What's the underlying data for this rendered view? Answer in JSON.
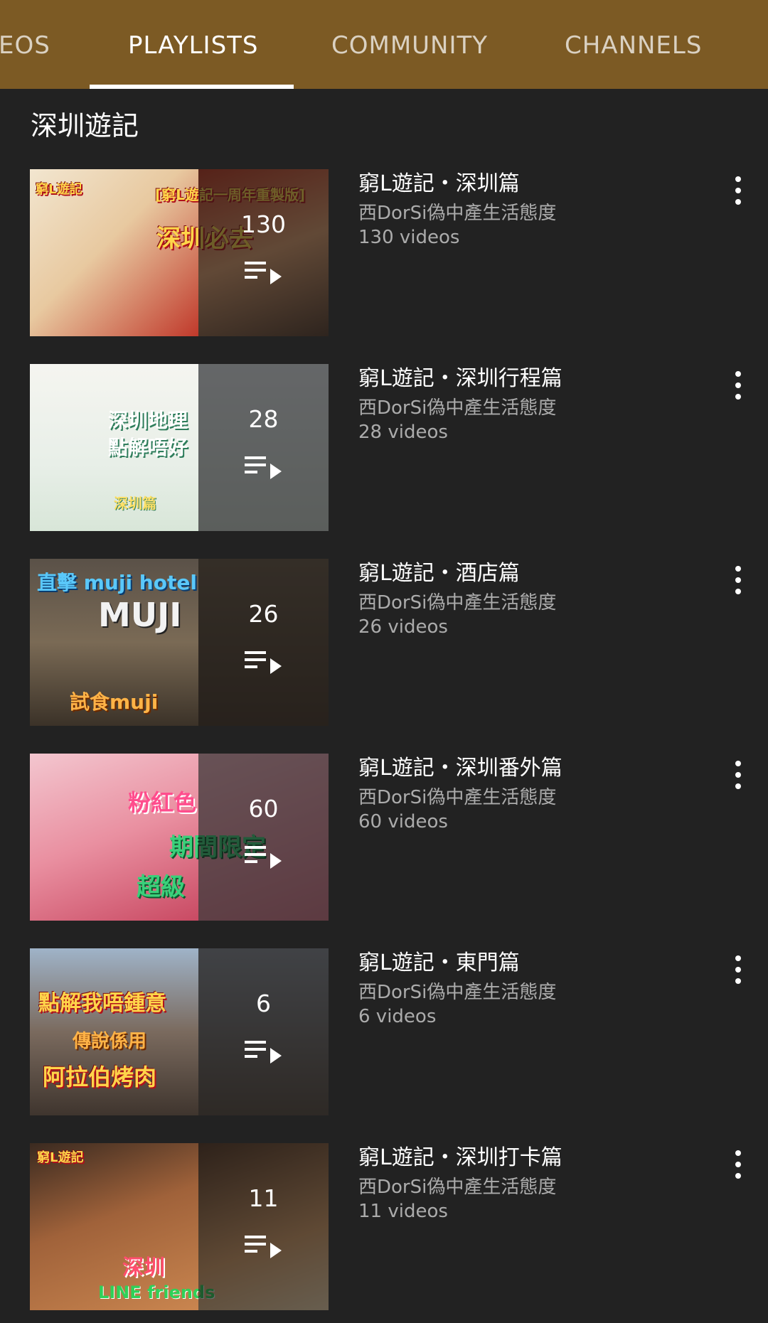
{
  "tabs": [
    {
      "label": "VIDEOS",
      "display": "EOS"
    },
    {
      "label": "PLAYLISTS",
      "display": "PLAYLISTS"
    },
    {
      "label": "COMMUNITY",
      "display": "COMMUNITY"
    },
    {
      "label": "CHANNELS",
      "display": "CHANNELS"
    }
  ],
  "active_tab": "PLAYLISTS",
  "section_title": "深圳遊記",
  "colors": {
    "tab_bar": "#7c5a24",
    "background": "#222222"
  },
  "playlists": [
    {
      "title": "窮L遊記・深圳篇",
      "channel": "西DorSi偽中產生活態度",
      "video_count_label": "130 videos",
      "thumb_count": "130",
      "thumb_caption": "深圳必去",
      "thumb_badge": "窮L遊記",
      "thumb_banner": "[窮L遊記一周年重製版]"
    },
    {
      "title": "窮L遊記・深圳行程篇",
      "channel": "西DorSi偽中產生活態度",
      "video_count_label": "28 videos",
      "thumb_count": "28",
      "thumb_caption": "深圳地理",
      "thumb_badge": "深圳篇",
      "thumb_banner": "點解唔好"
    },
    {
      "title": "窮L遊記・酒店篇",
      "channel": "西DorSi偽中產生活態度",
      "video_count_label": "26 videos",
      "thumb_count": "26",
      "thumb_caption": "直擊 muji hotel",
      "thumb_badge": "MUJI",
      "thumb_banner": "試食muji"
    },
    {
      "title": "窮L遊記・深圳番外篇",
      "channel": "西DorSi偽中產生活態度",
      "video_count_label": "60 videos",
      "thumb_count": "60",
      "thumb_caption": "粉紅色",
      "thumb_badge": "期間限定",
      "thumb_banner": "超級"
    },
    {
      "title": "窮L遊記・東門篇",
      "channel": "西DorSi偽中產生活態度",
      "video_count_label": "6 videos",
      "thumb_count": "6",
      "thumb_caption": "點解我唔鍾意",
      "thumb_badge": "傳說係用",
      "thumb_banner": "阿拉伯烤肉"
    },
    {
      "title": "窮L遊記・深圳打卡篇",
      "channel": "西DorSi偽中產生活態度",
      "video_count_label": "11 videos",
      "thumb_count": "11",
      "thumb_caption": "深圳",
      "thumb_badge": "窮L遊記",
      "thumb_banner": "LINE friends"
    }
  ]
}
